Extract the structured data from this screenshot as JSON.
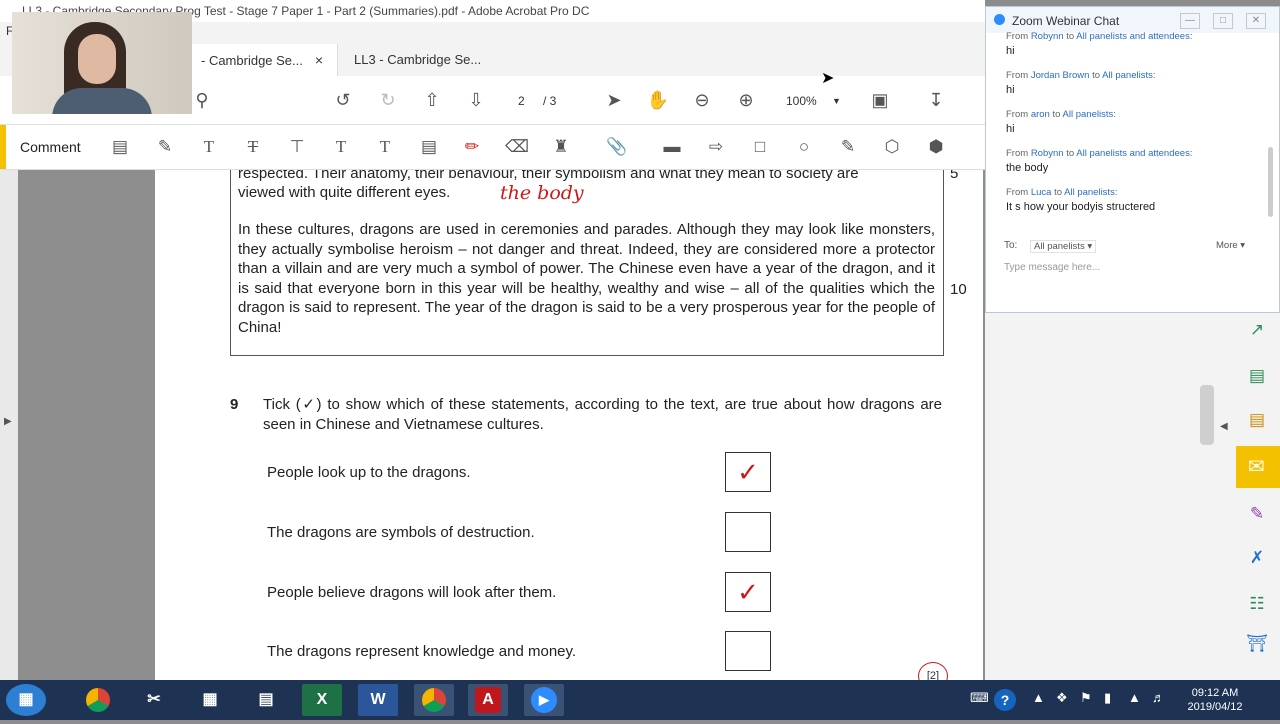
{
  "window": {
    "title": "LL3 - Cambridge Secondary Prog Test - Stage 7 Paper 1 - Part 2 (Summaries).pdf - Adobe Acrobat Pro DC",
    "menu_letter": "F"
  },
  "tabs": [
    {
      "label": "- Cambridge Se..."
    },
    {
      "label": "LL3 - Cambridge Se..."
    }
  ],
  "toolbar": {
    "page_current": "2",
    "page_total": "/ 3",
    "zoom": "100%"
  },
  "comment_bar": {
    "label": "Comment"
  },
  "document": {
    "para1_line1": "respected. Their anatomy, their behaviour, their symbolism and what they mean to society are",
    "para1_line2": "viewed with quite different eyes.",
    "line_no_5": "5",
    "para2": "In these cultures, dragons are used in ceremonies and parades. Although they may look like monsters, they actually symbolise heroism – not danger and threat. Indeed, they are considered more a protector than a villain and are very much a symbol of power. The Chinese even have a year of the dragon, and it is said that everyone born in this year will be healthy, wealthy and wise – all of the qualities which the dragon is said to represent. The year of the dragon is said to be a very prosperous year for the people of China!",
    "line_no_10": "10",
    "annotation": "the body",
    "question_number": "9",
    "question_text": "Tick (✓) to show which of these statements, according to the text, are true about how dragons are seen in Chinese and Vietnamese cultures.",
    "statements": [
      {
        "text": "People look up to the dragons.",
        "ticked": true
      },
      {
        "text": "The dragons are symbols of destruction.",
        "ticked": false
      },
      {
        "text": "People believe dragons will look after them.",
        "ticked": true
      },
      {
        "text": "The dragons represent knowledge and money.",
        "ticked": false
      }
    ],
    "tick_mark": "✓",
    "mark_box": "[2]"
  },
  "chat": {
    "title": "Zoom Webinar Chat",
    "messages": [
      {
        "from": "From",
        "sender": "Robynn",
        "to": "to",
        "recipient": "All panelists and attendees:",
        "text": "hi"
      },
      {
        "from": "From",
        "sender": "Jordan Brown",
        "to": "to",
        "recipient": "All panelists:",
        "text": "hi"
      },
      {
        "from": "From",
        "sender": "aron",
        "to": "to",
        "recipient": "All panelists:",
        "text": "hi"
      },
      {
        "from": "From",
        "sender": "Robynn",
        "to": "to",
        "recipient": "All panelists and attendees:",
        "text": "the body"
      },
      {
        "from": "From",
        "sender": "Luca",
        "to": "to",
        "recipient": "All panelists:",
        "text": "It s how your bodyis structered"
      }
    ],
    "to_label": "To:",
    "to_value": "All panelists",
    "more_label": "More",
    "input_placeholder": "Type message here..."
  },
  "taskbar": {
    "time": "09:12 AM",
    "date": "2019/04/12"
  },
  "colors": {
    "accent_yellow": "#f4c100",
    "annotation_red": "#d01818",
    "taskbar": "#1e3354",
    "zoom_blue": "#2b6cc4"
  }
}
